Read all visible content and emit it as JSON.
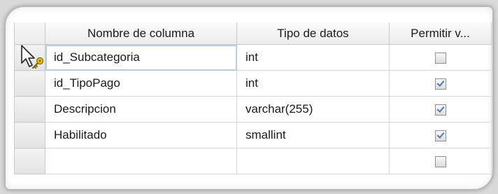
{
  "columns": {
    "name_header": "Nombre de columna",
    "type_header": "Tipo de datos",
    "null_header": "Permitir v..."
  },
  "rows": [
    {
      "name": "id_Subcategoria",
      "type": "int",
      "allow_nulls": false,
      "primary_key": true
    },
    {
      "name": "id_TipoPago",
      "type": "int",
      "allow_nulls": true,
      "primary_key": false
    },
    {
      "name": "Descripcion",
      "type": "varchar(255)",
      "allow_nulls": true,
      "primary_key": false
    },
    {
      "name": "Habilitado",
      "type": "smallint",
      "allow_nulls": true,
      "primary_key": false
    },
    {
      "name": "",
      "type": "",
      "allow_nulls": false,
      "primary_key": false
    }
  ],
  "icons": {
    "row_pointer": "current-row-pointer-icon",
    "primary_key": "primary-key-icon"
  },
  "colors": {
    "check": "#4a78b5",
    "active_cell_border": "#b9cde4"
  }
}
